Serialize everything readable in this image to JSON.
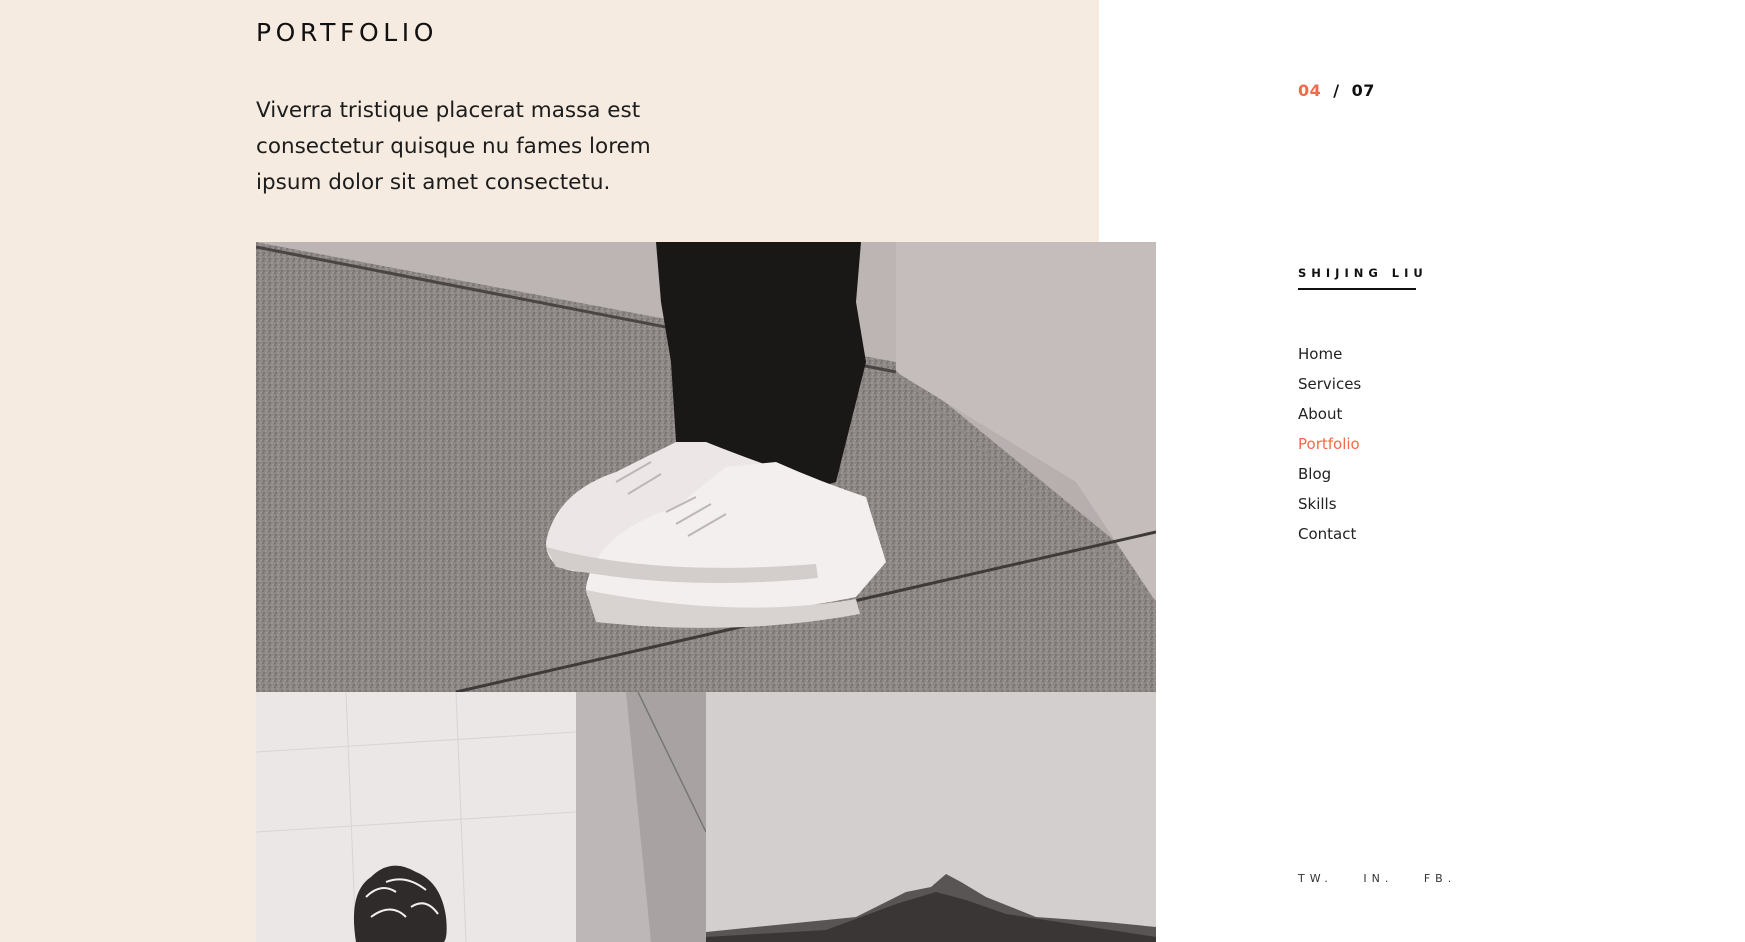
{
  "section": {
    "title": "PORTFOLIO",
    "intro": "Viverra tristique placerat massa est consectetur quisque nu fames lorem ipsum dolor sit amet consectetu."
  },
  "pager": {
    "current": "04",
    "separator": "/",
    "total": "07"
  },
  "brand": {
    "name": "SHIJING LIU"
  },
  "nav": {
    "items": [
      {
        "label": "Home"
      },
      {
        "label": "Services"
      },
      {
        "label": "About"
      },
      {
        "label": "Portfolio",
        "active": true
      },
      {
        "label": "Blog"
      },
      {
        "label": "Skills"
      },
      {
        "label": "Contact"
      }
    ]
  },
  "socials": {
    "items": [
      {
        "label": "TW."
      },
      {
        "label": "IN."
      },
      {
        "label": "FB."
      }
    ]
  },
  "colors": {
    "accent": "#f26a4b",
    "panel_bg": "#f5ebe0",
    "text": "#111111"
  }
}
